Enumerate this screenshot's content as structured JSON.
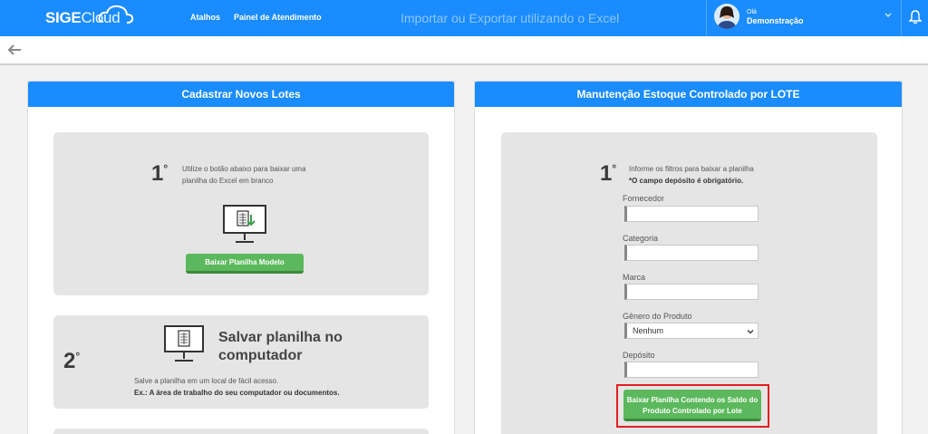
{
  "brand": {
    "logo_bold": "SIGE",
    "logo_light": "Cloud"
  },
  "nav": {
    "atalhos": "Atalhos",
    "painel": "Painel de Atendimento"
  },
  "page_heading": "Importar ou Exportar utilizando o Excel",
  "user": {
    "greeting": "Olá",
    "name": "Demonstração"
  },
  "left_panel": {
    "title": "Cadastrar Novos Lotes",
    "step1": {
      "number": "1",
      "ordinal": "°",
      "text_line1": "Utilize o botão abaixo para baixar uma",
      "text_line2": "planilha do Excel em branco",
      "button": "Baixar Planilha Modelo"
    },
    "step2": {
      "number": "2",
      "ordinal": "°",
      "title_line1": "Salvar planilha no",
      "title_line2": "computador",
      "text": "Salve a planilha em um local de fácil acesso.",
      "example": "Ex.: A área de trabalho do seu computador ou documentos."
    }
  },
  "right_panel": {
    "title": "Manutenção Estoque Controlado por LOTE",
    "step1": {
      "number": "1",
      "ordinal": "°",
      "text_line1": "Informe os filtros para baixar a planilha",
      "text_line2": "*O campo depósito é obrigatório."
    },
    "fields": {
      "fornecedor": {
        "label": "Fornecedor",
        "value": ""
      },
      "categoria": {
        "label": "Categoria",
        "value": ""
      },
      "marca": {
        "label": "Marca",
        "value": ""
      },
      "genero": {
        "label": "Gênero do Produto",
        "selected": "Nenhum"
      },
      "deposito": {
        "label": "Depósito",
        "value": ""
      }
    },
    "button_line1": "Baixar Planilha Contendo os Saldo do",
    "button_line2": "Produto Controlado por Lote"
  },
  "colors": {
    "primary": "#1a8cff",
    "success": "#5cb85c",
    "highlight": "#e02020"
  }
}
